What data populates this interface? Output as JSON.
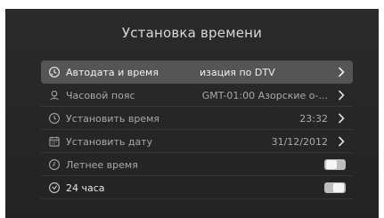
{
  "title": "Установка времени",
  "items": [
    {
      "label": "Автодата и время",
      "value": "изация по DTV",
      "icon": "auto-clock-icon",
      "control": "chevron"
    },
    {
      "label": "Часовой пояс",
      "value": "GMT-01:00 Азорские о-...",
      "icon": "globe-pin-icon",
      "control": "chevron"
    },
    {
      "label": "Установить время",
      "value": "23:32",
      "icon": "clock-icon",
      "control": "chevron"
    },
    {
      "label": "Установить дату",
      "value": "31/12/2012",
      "icon": "calendar-icon",
      "control": "chevron"
    },
    {
      "label": "Летнее время",
      "value": "",
      "icon": "clock-alt-icon",
      "control": "toggle",
      "state": "off"
    },
    {
      "label": "24 часа",
      "value": "",
      "icon": "clock-24-icon",
      "control": "toggle",
      "state": "on"
    }
  ]
}
